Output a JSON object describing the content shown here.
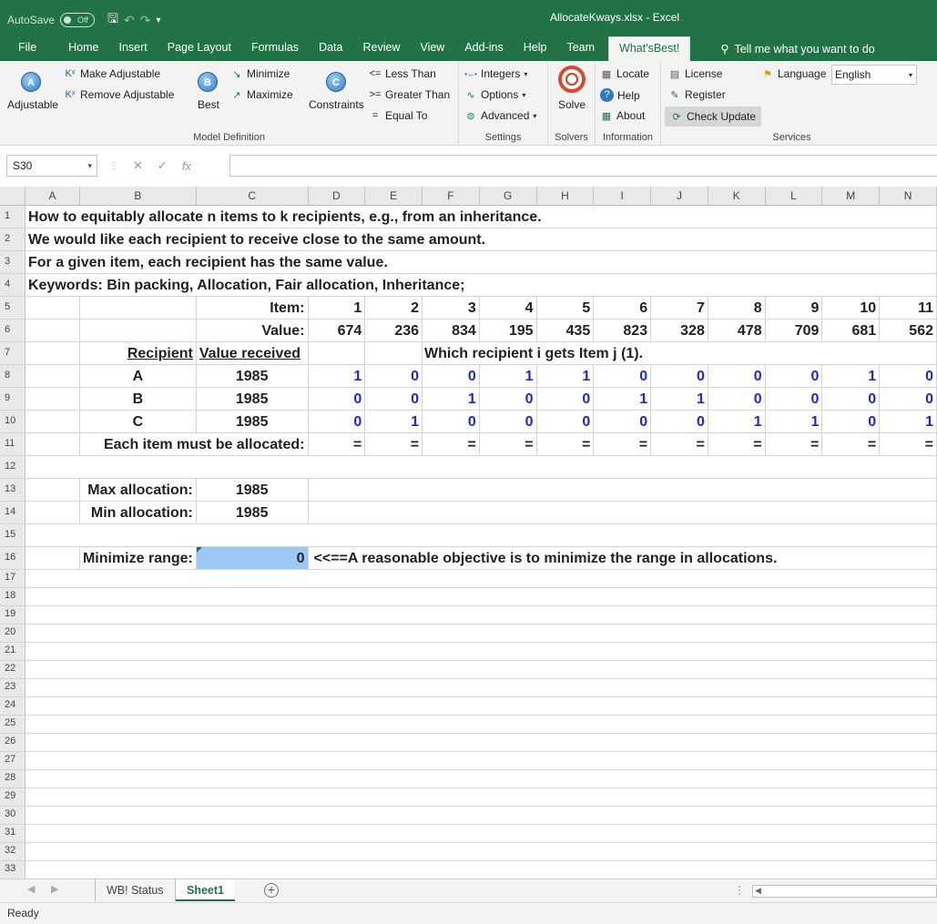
{
  "titlebar": {
    "autosave_label": "AutoSave",
    "autosave_state": "Off",
    "title": "AllocateKways.xlsx  -  Excel"
  },
  "tabs": [
    "File",
    "Home",
    "Insert",
    "Page Layout",
    "Formulas",
    "Data",
    "Review",
    "View",
    "Add-ins",
    "Help",
    "Team",
    "What'sBest!"
  ],
  "active_tab": "What'sBest!",
  "tellme": "Tell me what you want to do",
  "ribbon": {
    "adjustable": "Adjustable",
    "make_adjustable": "Make Adjustable",
    "remove_adjustable": "Remove Adjustable",
    "best": "Best",
    "minimize": "Minimize",
    "maximize": "Maximize",
    "constraints": "Constraints",
    "less_than": "Less Than",
    "greater_than": "Greater Than",
    "equal_to": "Equal To",
    "model_definition": "Model Definition",
    "integers": "Integers",
    "options": "Options",
    "advanced": "Advanced",
    "settings": "Settings",
    "solve": "Solve",
    "solvers": "Solvers",
    "locate": "Locate",
    "help": "Help",
    "about": "About",
    "information": "Information",
    "license": "License",
    "register": "Register",
    "check_update": "Check Update",
    "language_label": "Language",
    "language_value": "English",
    "services": "Services"
  },
  "formula_bar": {
    "name_box": "S30",
    "formula": ""
  },
  "columns": [
    "A",
    "B",
    "C",
    "D",
    "E",
    "F",
    "G",
    "H",
    "I",
    "J",
    "K",
    "L",
    "M",
    "N"
  ],
  "sheet": {
    "r1": "How to equitably allocate  n  items to k  recipients, e.g., from an inheritance.",
    "r2": "We would like each recipient to receive close to the same amount.",
    "r3": "For a given item, each recipient has the same value.",
    "r4": "Keywords: Bin packing, Allocation, Fair allocation, Inheritance;",
    "item_label": "Item:",
    "items": [
      "1",
      "2",
      "3",
      "4",
      "5",
      "6",
      "7",
      "8",
      "9",
      "10",
      "11"
    ],
    "value_label": "Value:",
    "values": [
      "674",
      "236",
      "834",
      "195",
      "435",
      "823",
      "328",
      "478",
      "709",
      "681",
      "562"
    ],
    "recipient_header": "Recipient",
    "value_received_header": "Value received",
    "which_header": "Which recipient i  gets Item j  (1).",
    "recipients": [
      {
        "name": "A",
        "received": "1985",
        "alloc": [
          "1",
          "0",
          "0",
          "1",
          "1",
          "0",
          "0",
          "0",
          "0",
          "1",
          "0"
        ]
      },
      {
        "name": "B",
        "received": "1985",
        "alloc": [
          "0",
          "0",
          "1",
          "0",
          "0",
          "1",
          "1",
          "0",
          "0",
          "0",
          "0"
        ]
      },
      {
        "name": "C",
        "received": "1985",
        "alloc": [
          "0",
          "1",
          "0",
          "0",
          "0",
          "0",
          "0",
          "1",
          "1",
          "0",
          "1"
        ]
      }
    ],
    "each_item_label": "Each item must be allocated:",
    "eq": [
      "=",
      "=",
      "=",
      "=",
      "=",
      "=",
      "=",
      "=",
      "=",
      "=",
      "="
    ],
    "max_label": "Max allocation:",
    "max_value": "1985",
    "min_label": "Min allocation:",
    "min_value": "1985",
    "minrange_label": "Minimize range:",
    "minrange_value": "0",
    "objective_note": "<<==A reasonable objective is to minimize the range in allocations."
  },
  "sheet_tabs": [
    "WB! Status",
    "Sheet1"
  ],
  "active_sheet": "Sheet1",
  "status": "Ready"
}
